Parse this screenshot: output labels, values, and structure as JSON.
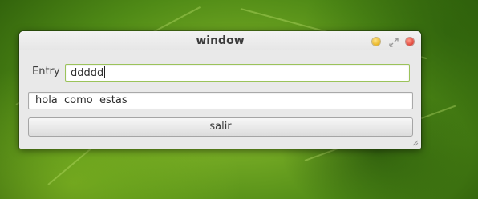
{
  "window": {
    "title": "window",
    "controls": {
      "minimize_icon": "minimize-icon",
      "maximize_icon": "maximize-icon",
      "close_icon": "close-icon"
    }
  },
  "form": {
    "entry_label": "Entry",
    "entry_value": "ddddd",
    "text_value": "hola  como  estas",
    "button_label": "salir"
  },
  "colors": {
    "focus_border": "#9bc35a",
    "close": "#e0463a",
    "minimize": "#e8b320"
  }
}
